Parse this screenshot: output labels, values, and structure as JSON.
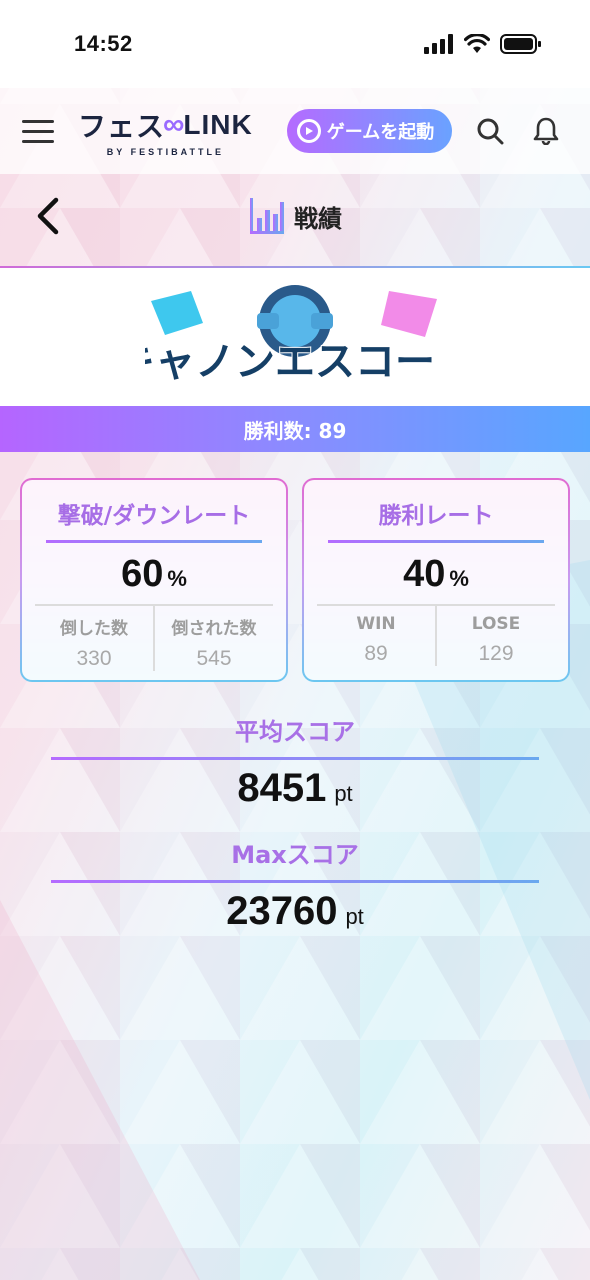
{
  "status": {
    "time": "14:52",
    "icons": [
      "signal-icon",
      "wifi-icon",
      "battery-icon"
    ]
  },
  "header": {
    "logo_main_left": "フェス",
    "logo_main_right": "LINK",
    "logo_sub": "BY FESTIBATTLE",
    "launch_label": "ゲームを起動",
    "icons": [
      "menu-icon",
      "search-icon",
      "bell-icon"
    ]
  },
  "title_bar": {
    "title": "戦績",
    "icon": "bar-chart-icon"
  },
  "game": {
    "name": "キャノンエスコート",
    "wins_label": "勝利数: 89"
  },
  "cards": [
    {
      "title": "撃破/ダウンレート",
      "value": "60",
      "unit": "%",
      "left_label": "倒した数",
      "left_value": "330",
      "right_label": "倒された数",
      "right_value": "545"
    },
    {
      "title": "勝利レート",
      "value": "40",
      "unit": "%",
      "left_label": "WIN",
      "left_value": "89",
      "right_label": "LOSE",
      "right_value": "129"
    }
  ],
  "scores": [
    {
      "title": "平均スコア",
      "value": "8451",
      "unit": "pt"
    },
    {
      "title": "Maxスコア",
      "value": "23760",
      "unit": "pt"
    }
  ],
  "colors": {
    "accent_purple": "#b56bff",
    "accent_blue": "#58a6ff",
    "title_purple": "#a76ee6"
  }
}
